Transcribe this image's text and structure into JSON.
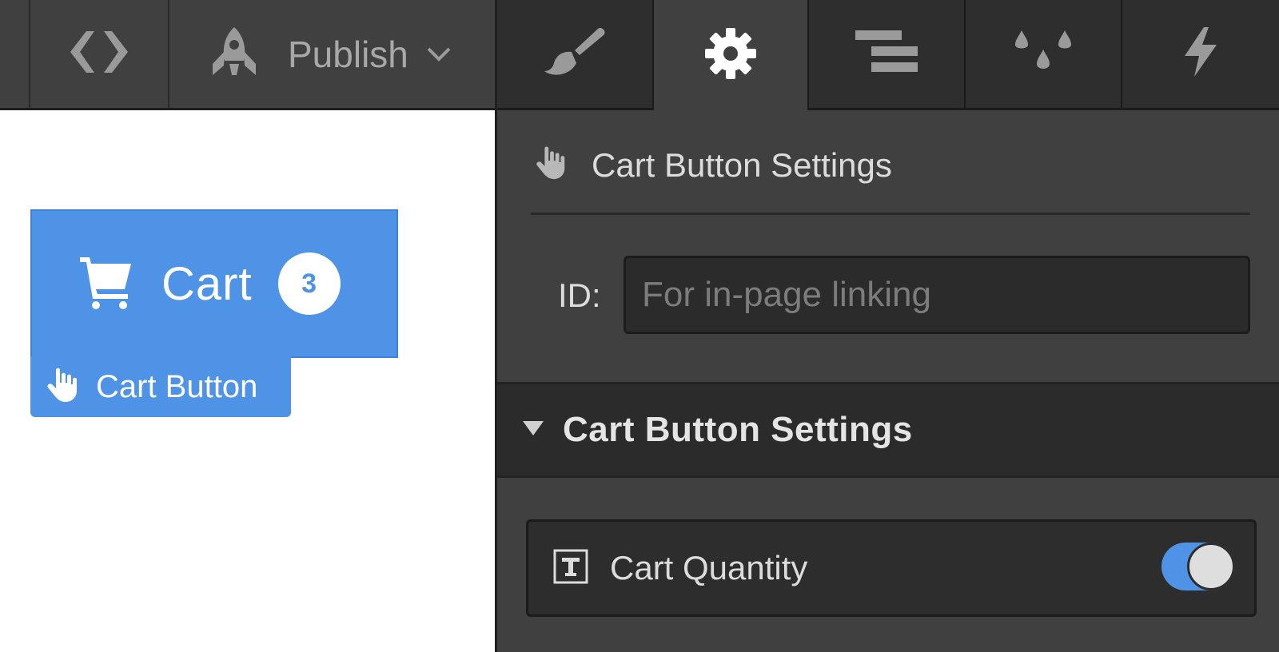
{
  "topbar": {
    "code_icon": "code-brackets-icon",
    "publish_icon": "rocket-icon",
    "publish_label": "Publish",
    "publish_chevron": "chevron-down-icon"
  },
  "tabs": [
    {
      "name": "style",
      "icon": "paintbrush-icon",
      "active": false
    },
    {
      "name": "settings",
      "icon": "gear-icon",
      "active": true
    },
    {
      "name": "navigator",
      "icon": "navigator-lines-icon",
      "active": false
    },
    {
      "name": "assets",
      "icon": "drops-icon",
      "active": false
    },
    {
      "name": "interactions",
      "icon": "lightning-icon",
      "active": false
    }
  ],
  "canvas": {
    "cart_button": {
      "icon": "cart-icon",
      "label": "Cart",
      "quantity": "3"
    },
    "element_tag": {
      "icon": "hand-pointer-icon",
      "label": "Cart Button"
    }
  },
  "panel": {
    "header_icon": "hand-pointer-icon",
    "header_title": "Cart Button Settings",
    "id_label": "ID:",
    "id_value": "",
    "id_placeholder": "For in-page linking",
    "section": {
      "title": "Cart Button Settings",
      "expanded": true
    },
    "cart_quantity": {
      "icon": "text-field-icon",
      "label": "Cart Quantity",
      "enabled": true
    }
  },
  "colors": {
    "accent": "#4f93e6",
    "panel_bg": "#404040",
    "dark_bg": "#2b2b2b",
    "text": "#dcdcdc",
    "muted": "#a8a8a8"
  }
}
